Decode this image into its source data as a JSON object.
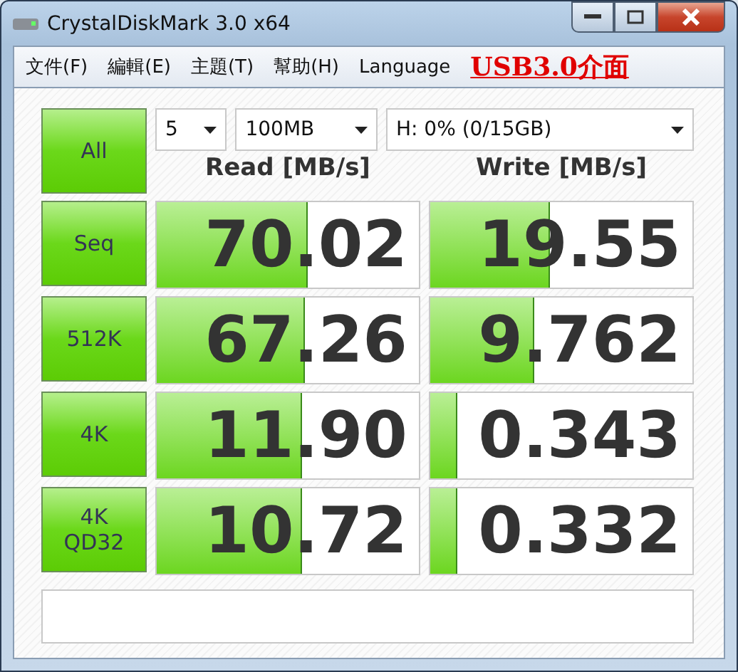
{
  "window": {
    "title": "CrystalDiskMark 3.0 x64"
  },
  "menu": [
    "文件(F)",
    "編輯(E)",
    "主題(T)",
    "幫助(H)",
    "Language"
  ],
  "annotation": "USB3.0介面",
  "all_button": "All",
  "selectors": [
    {
      "value": "5"
    },
    {
      "value": "100MB"
    },
    {
      "value": "H: 0% (0/15GB)"
    }
  ],
  "headers": [
    "Read [MB/s]",
    "Write [MB/s]"
  ],
  "rows": [
    {
      "label": "Seq",
      "read": {
        "value": "70.02",
        "level": 0.57
      },
      "write": {
        "value": "19.55",
        "level": 0.45
      }
    },
    {
      "label": "512K",
      "read": {
        "value": "67.26",
        "level": 0.56
      },
      "write": {
        "value": "9.762",
        "level": 0.39
      }
    },
    {
      "label": "4K",
      "read": {
        "value": "11.90",
        "level": 0.55
      },
      "write": {
        "value": "0.343",
        "level": 0.1
      }
    },
    {
      "label": "4K\nQD32",
      "read": {
        "value": "10.72",
        "level": 0.55
      },
      "write": {
        "value": "0.332",
        "level": 0.1
      }
    }
  ]
}
